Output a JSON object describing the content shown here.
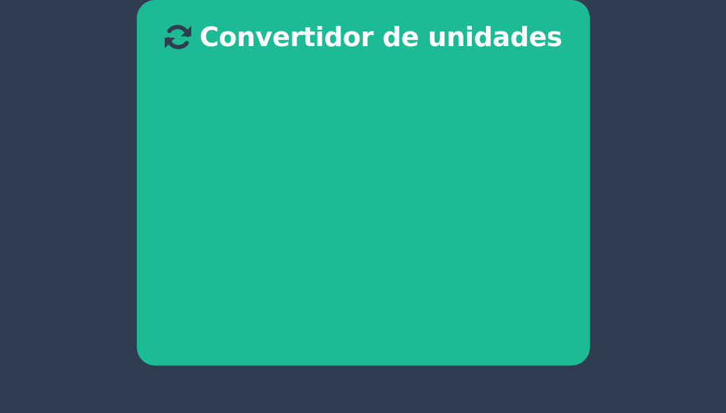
{
  "app": {
    "title": "Convertidor de unidades",
    "icon": "refresh-icon"
  },
  "colors": {
    "background": "#2e3d50",
    "card": "#1dbb95",
    "text": "#ffffff",
    "icon": "#2e3d50"
  }
}
